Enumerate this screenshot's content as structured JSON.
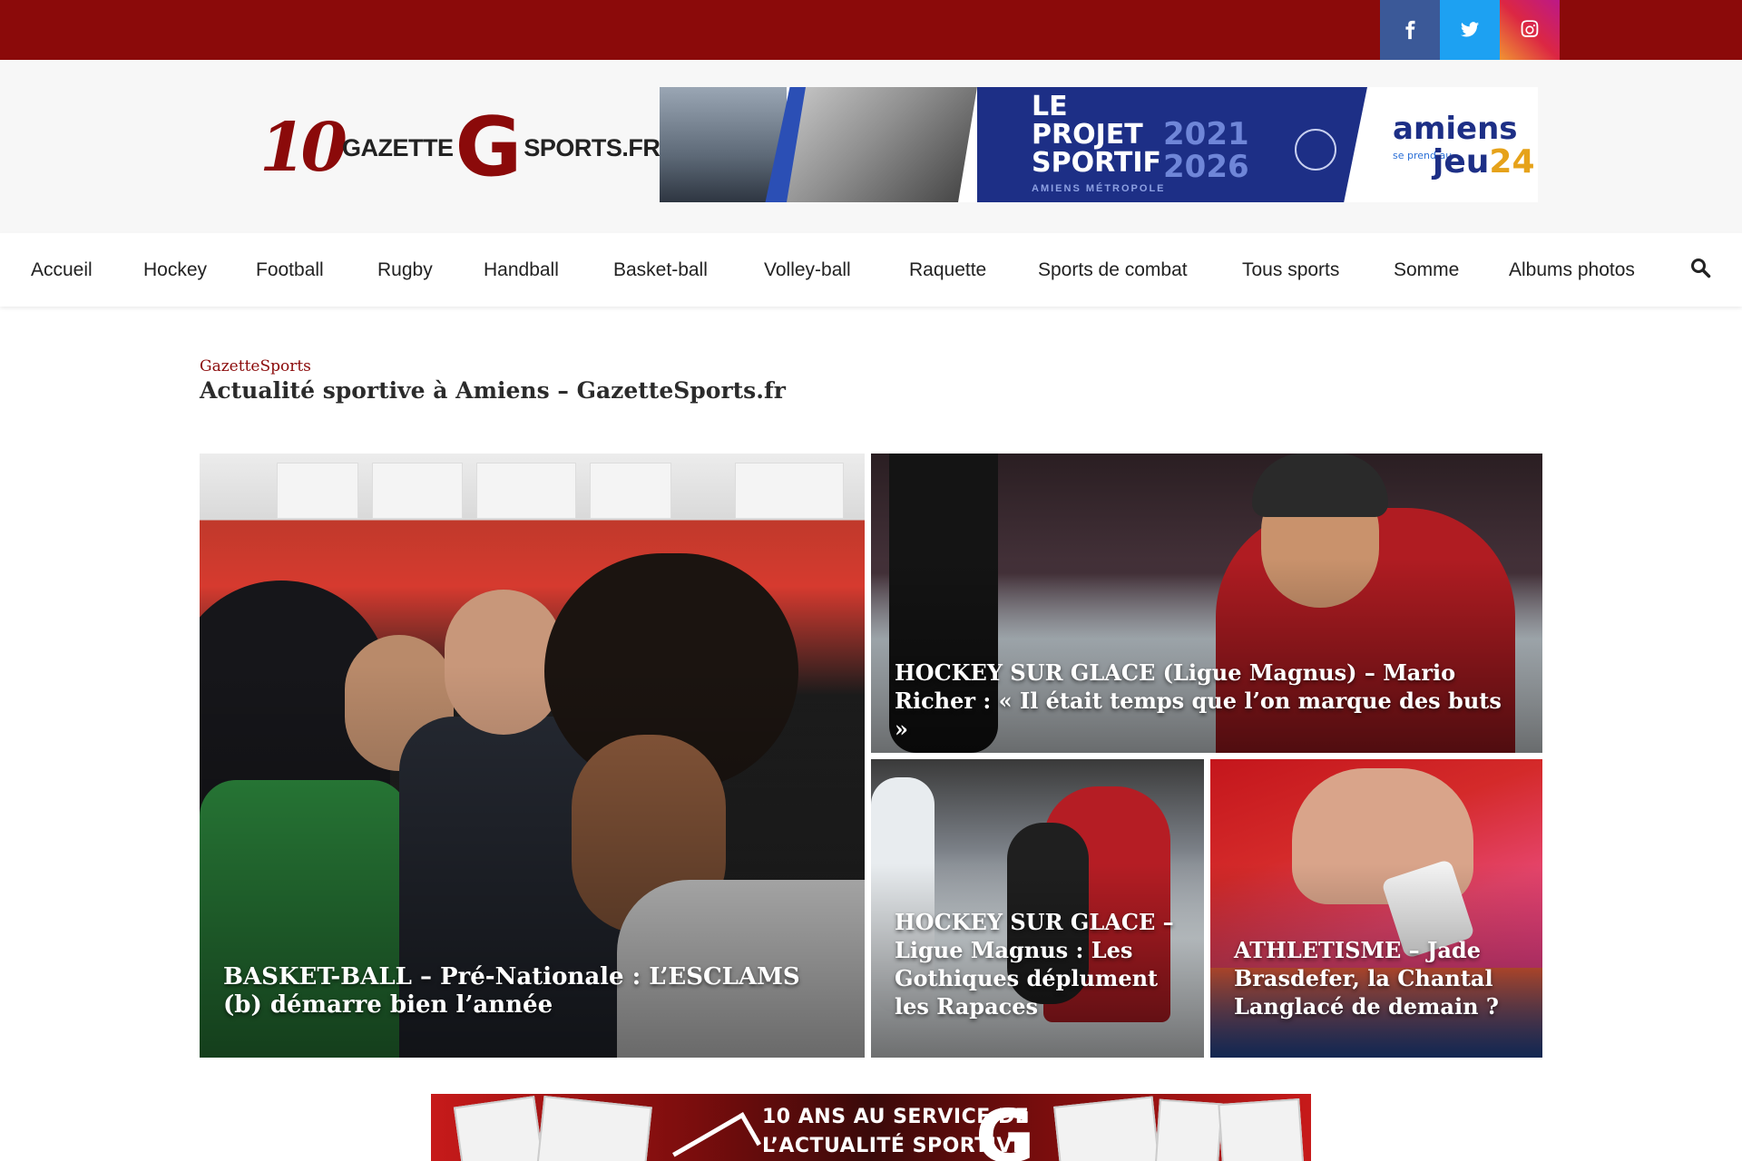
{
  "social": {
    "facebook": "facebook-icon",
    "twitter": "twitter-icon",
    "instagram": "instagram-icon"
  },
  "logo": {
    "mark": "10",
    "left_word": "GAZETTE",
    "g": "G",
    "right_word": "SPORTS.FR"
  },
  "banner": {
    "title_line1": "LE",
    "title_line2": "PROJET",
    "title_line3": "SPORTIF",
    "year_start": "2021",
    "year_end": "2026",
    "subtitle": "AMIENS MÉTROPOLE",
    "brand": "amiens",
    "tagline": "se prend au",
    "brand_jeu": "jeu",
    "brand_24": "24"
  },
  "nav": {
    "items": [
      {
        "label": "Accueil"
      },
      {
        "label": "Hockey"
      },
      {
        "label": "Football"
      },
      {
        "label": "Rugby"
      },
      {
        "label": "Handball"
      },
      {
        "label": "Basket-ball"
      },
      {
        "label": "Volley-ball"
      },
      {
        "label": "Raquette"
      },
      {
        "label": "Sports de combat"
      },
      {
        "label": "Tous sports"
      },
      {
        "label": "Somme"
      },
      {
        "label": "Albums photos"
      }
    ],
    "search_icon": "search-icon"
  },
  "site": {
    "kicker": "GazetteSports",
    "title": "Actualité sportive à Amiens – GazetteSports.fr"
  },
  "articles": [
    {
      "title": "BASKET-BALL – Pré-Nationale : L’ESCLAMS (b) démarre bien l’année"
    },
    {
      "title": "HOCKEY SUR GLACE (Ligue Magnus) – Mario Richer : « Il était temps que l’on marque des buts »"
    },
    {
      "title": "HOCKEY SUR GLACE – Ligue Magnus : Les Gothiques déplument les Rapaces"
    },
    {
      "title": "ATHLETISME – Jade Brasdefer, la Chantal Langlacé de demain ?"
    }
  ],
  "ad_bottom": {
    "line1": "10 ANS AU SERVICE DE",
    "line2": "L’ACTUALITÉ SPORTIVE",
    "g": "G"
  }
}
